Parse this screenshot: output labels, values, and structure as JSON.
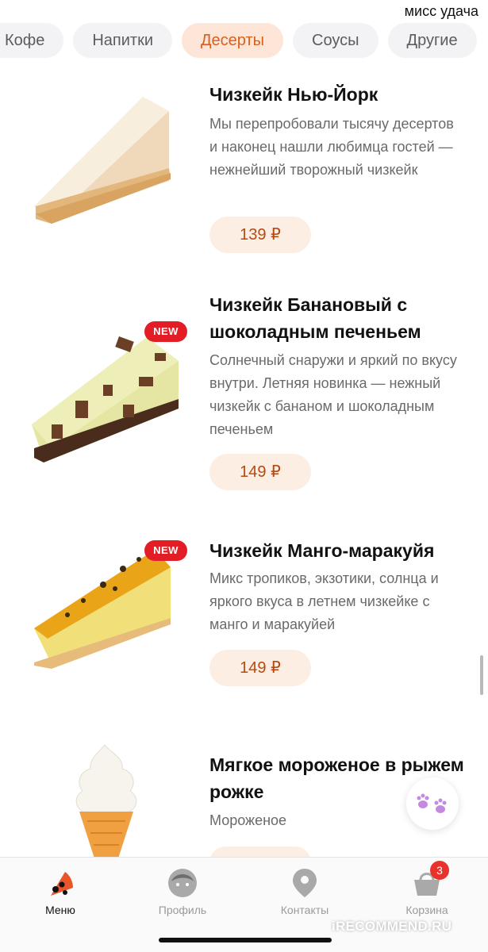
{
  "watermark_top": "мисс удача",
  "categories": [
    {
      "label": "Кофе",
      "active": false
    },
    {
      "label": "Напитки",
      "active": false
    },
    {
      "label": "Десерты",
      "active": true
    },
    {
      "label": "Соусы",
      "active": false
    },
    {
      "label": "Другие",
      "active": false
    }
  ],
  "products": [
    {
      "title": "Чизкейк Нью-Йорк",
      "description": "Мы перепробовали тысячу десертов и наконец нашли любимца гостей — нежнейший творожный чизкейк",
      "price": "139 ₽",
      "is_new": false
    },
    {
      "title": "Чизкейк Банановый с шоколадным печеньем",
      "description": "Солнечный снаружи и яркий по вкусу внутри. Летняя новинка — нежный чизкейк с бананом и шоколадным печеньем",
      "price": "149 ₽",
      "is_new": true,
      "badge": "NEW"
    },
    {
      "title": "Чизкейк Манго-маракуйя",
      "description": "Микс тропиков, экзотики, солнца и яркого вкуса в летнем чизкейке с манго и маракуйей",
      "price": "149 ₽",
      "is_new": true,
      "badge": "NEW"
    },
    {
      "title": "Мягкое мороженое в рыжем рожке",
      "description": "Мороженое",
      "price": "",
      "is_new": false
    }
  ],
  "tabbar": {
    "items": [
      {
        "label": "Меню",
        "icon": "pizza-icon",
        "active": true
      },
      {
        "label": "Профиль",
        "icon": "profile-icon",
        "active": false
      },
      {
        "label": "Контакты",
        "icon": "location-pin-icon",
        "active": false
      },
      {
        "label": "Корзина",
        "icon": "basket-icon",
        "active": false,
        "badge": "3"
      }
    ]
  },
  "watermark_bottom": "iRECOMMEND.RU",
  "colors": {
    "accent": "#d95f1c",
    "accent_bg": "#fde6d8",
    "price_text": "#b54a12",
    "new_badge": "#e21d26",
    "cart_badge": "#e8332c"
  }
}
